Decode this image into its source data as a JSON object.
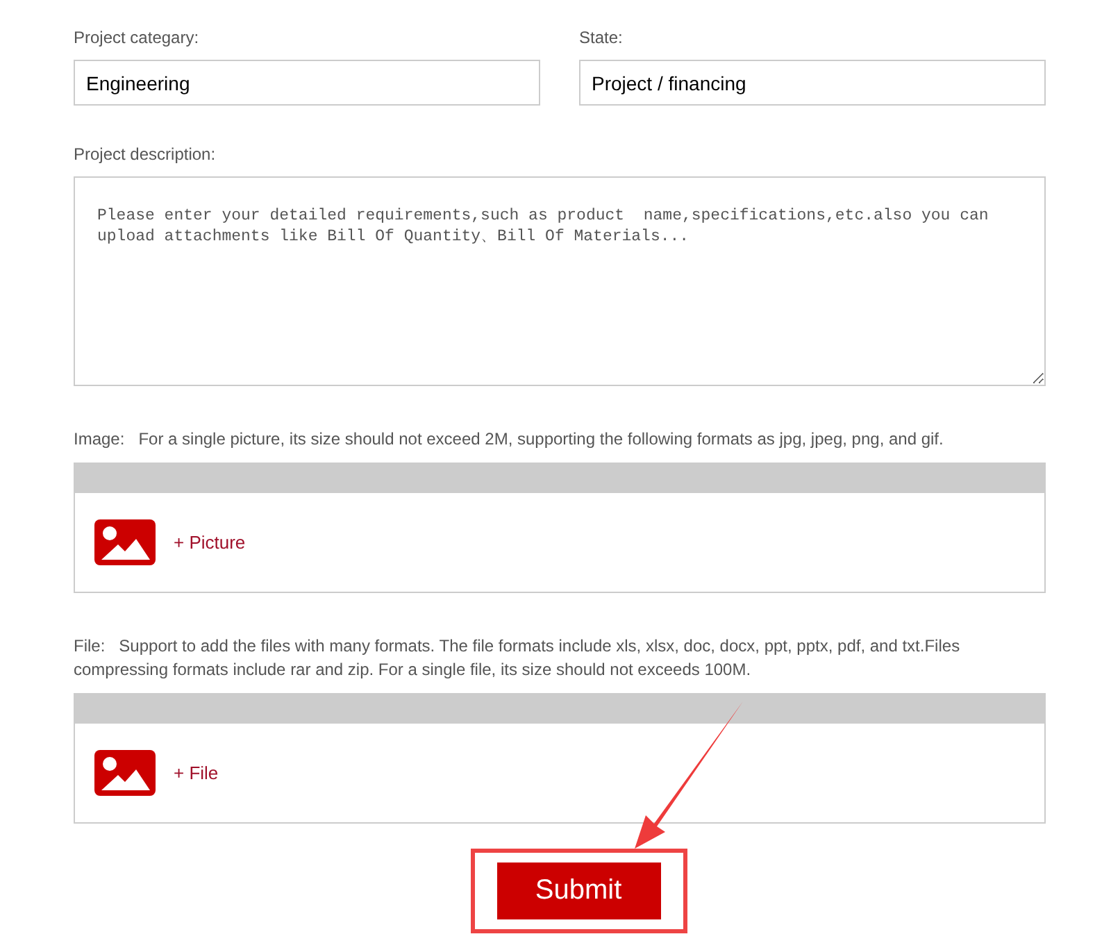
{
  "fields": [
    {
      "label": "Project categary:",
      "value": "Engineering"
    },
    {
      "label": "State:",
      "value": "Project / financing"
    }
  ],
  "description": {
    "label": "Project description:",
    "placeholder": "Please enter your detailed requirements,such as product  name,specifications,etc.also you can upload attachments like Bill Of Quantity、Bill Of Materials..."
  },
  "uploads": [
    {
      "label": "Image:",
      "hint": "For a single picture, its size should not exceed 2M, supporting the following formats as jpg, jpeg, png, and gif.",
      "action": "+ Picture"
    },
    {
      "label": "File:",
      "hint": "Support to add the files with many formats. The file formats include xls, xlsx, doc, docx, ppt, pptx, pdf, and txt.Files compressing formats include rar and zip. For a single file, its size should not exceeds 100M.",
      "action": "+ File"
    }
  ],
  "submit": "Submit"
}
